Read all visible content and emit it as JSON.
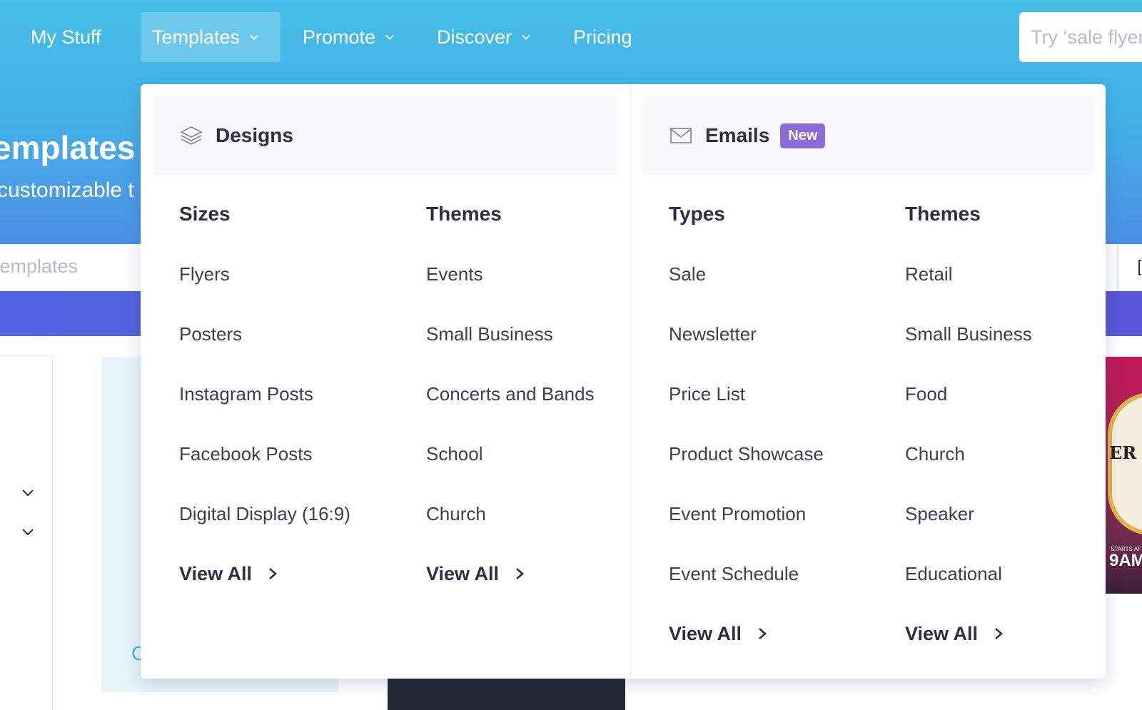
{
  "nav": {
    "items": [
      {
        "label": "My Stuff",
        "has_dropdown": false,
        "active": false
      },
      {
        "label": "Templates",
        "has_dropdown": true,
        "active": true
      },
      {
        "label": "Promote",
        "has_dropdown": true,
        "active": false
      },
      {
        "label": "Discover",
        "has_dropdown": true,
        "active": false
      },
      {
        "label": "Pricing",
        "has_dropdown": false,
        "active": false
      }
    ],
    "search_placeholder": "Try ‘sale flyer"
  },
  "hero": {
    "title": "emplates",
    "subtitle": "customizable t"
  },
  "search": {
    "placeholder": "templates"
  },
  "background_card": {
    "partial_text": "C"
  },
  "poster": {
    "text": "ER",
    "small": "STARTS AT",
    "time": "9AM"
  },
  "mega_menu": {
    "designs": {
      "icon": "layers-icon",
      "title": "Designs",
      "columns": [
        {
          "heading": "Sizes",
          "links": [
            "Flyers",
            "Posters",
            "Instagram Posts",
            "Facebook Posts",
            "Digital Display (16:9)"
          ],
          "view_all": "View All"
        },
        {
          "heading": "Themes",
          "links": [
            "Events",
            "Small Business",
            "Concerts and Bands",
            "School",
            "Church"
          ],
          "view_all": "View All"
        }
      ]
    },
    "emails": {
      "icon": "envelope-icon",
      "title": "Emails",
      "badge": "New",
      "columns": [
        {
          "heading": "Types",
          "links": [
            "Sale",
            "Newsletter",
            "Price List",
            "Product Showcase",
            "Event Promotion",
            "Event Schedule"
          ],
          "view_all": "View All"
        },
        {
          "heading": "Themes",
          "links": [
            "Retail",
            "Small Business",
            "Food",
            "Church",
            "Speaker",
            "Educational"
          ],
          "view_all": "View All"
        }
      ]
    }
  },
  "colors": {
    "header_top": "#45bde6",
    "band_purple": "#5164e3",
    "badge_purple": "#8e6bd9",
    "text_dark": "#2c2f45"
  }
}
